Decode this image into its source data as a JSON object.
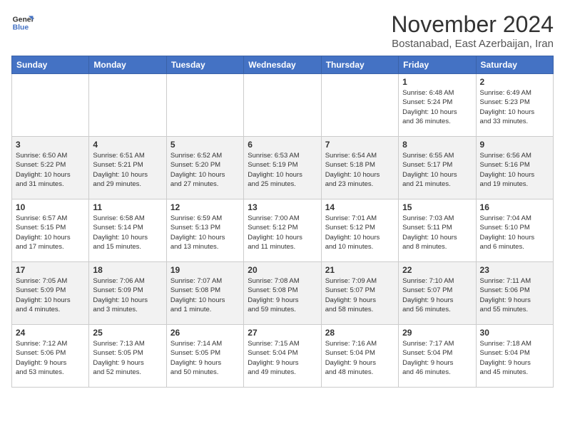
{
  "header": {
    "logo_line1": "General",
    "logo_line2": "Blue",
    "month": "November 2024",
    "location": "Bostanabad, East Azerbaijan, Iran"
  },
  "weekdays": [
    "Sunday",
    "Monday",
    "Tuesday",
    "Wednesday",
    "Thursday",
    "Friday",
    "Saturday"
  ],
  "weeks": [
    [
      {
        "day": "",
        "info": ""
      },
      {
        "day": "",
        "info": ""
      },
      {
        "day": "",
        "info": ""
      },
      {
        "day": "",
        "info": ""
      },
      {
        "day": "",
        "info": ""
      },
      {
        "day": "1",
        "info": "Sunrise: 6:48 AM\nSunset: 5:24 PM\nDaylight: 10 hours\nand 36 minutes."
      },
      {
        "day": "2",
        "info": "Sunrise: 6:49 AM\nSunset: 5:23 PM\nDaylight: 10 hours\nand 33 minutes."
      }
    ],
    [
      {
        "day": "3",
        "info": "Sunrise: 6:50 AM\nSunset: 5:22 PM\nDaylight: 10 hours\nand 31 minutes."
      },
      {
        "day": "4",
        "info": "Sunrise: 6:51 AM\nSunset: 5:21 PM\nDaylight: 10 hours\nand 29 minutes."
      },
      {
        "day": "5",
        "info": "Sunrise: 6:52 AM\nSunset: 5:20 PM\nDaylight: 10 hours\nand 27 minutes."
      },
      {
        "day": "6",
        "info": "Sunrise: 6:53 AM\nSunset: 5:19 PM\nDaylight: 10 hours\nand 25 minutes."
      },
      {
        "day": "7",
        "info": "Sunrise: 6:54 AM\nSunset: 5:18 PM\nDaylight: 10 hours\nand 23 minutes."
      },
      {
        "day": "8",
        "info": "Sunrise: 6:55 AM\nSunset: 5:17 PM\nDaylight: 10 hours\nand 21 minutes."
      },
      {
        "day": "9",
        "info": "Sunrise: 6:56 AM\nSunset: 5:16 PM\nDaylight: 10 hours\nand 19 minutes."
      }
    ],
    [
      {
        "day": "10",
        "info": "Sunrise: 6:57 AM\nSunset: 5:15 PM\nDaylight: 10 hours\nand 17 minutes."
      },
      {
        "day": "11",
        "info": "Sunrise: 6:58 AM\nSunset: 5:14 PM\nDaylight: 10 hours\nand 15 minutes."
      },
      {
        "day": "12",
        "info": "Sunrise: 6:59 AM\nSunset: 5:13 PM\nDaylight: 10 hours\nand 13 minutes."
      },
      {
        "day": "13",
        "info": "Sunrise: 7:00 AM\nSunset: 5:12 PM\nDaylight: 10 hours\nand 11 minutes."
      },
      {
        "day": "14",
        "info": "Sunrise: 7:01 AM\nSunset: 5:12 PM\nDaylight: 10 hours\nand 10 minutes."
      },
      {
        "day": "15",
        "info": "Sunrise: 7:03 AM\nSunset: 5:11 PM\nDaylight: 10 hours\nand 8 minutes."
      },
      {
        "day": "16",
        "info": "Sunrise: 7:04 AM\nSunset: 5:10 PM\nDaylight: 10 hours\nand 6 minutes."
      }
    ],
    [
      {
        "day": "17",
        "info": "Sunrise: 7:05 AM\nSunset: 5:09 PM\nDaylight: 10 hours\nand 4 minutes."
      },
      {
        "day": "18",
        "info": "Sunrise: 7:06 AM\nSunset: 5:09 PM\nDaylight: 10 hours\nand 3 minutes."
      },
      {
        "day": "19",
        "info": "Sunrise: 7:07 AM\nSunset: 5:08 PM\nDaylight: 10 hours\nand 1 minute."
      },
      {
        "day": "20",
        "info": "Sunrise: 7:08 AM\nSunset: 5:08 PM\nDaylight: 9 hours\nand 59 minutes."
      },
      {
        "day": "21",
        "info": "Sunrise: 7:09 AM\nSunset: 5:07 PM\nDaylight: 9 hours\nand 58 minutes."
      },
      {
        "day": "22",
        "info": "Sunrise: 7:10 AM\nSunset: 5:07 PM\nDaylight: 9 hours\nand 56 minutes."
      },
      {
        "day": "23",
        "info": "Sunrise: 7:11 AM\nSunset: 5:06 PM\nDaylight: 9 hours\nand 55 minutes."
      }
    ],
    [
      {
        "day": "24",
        "info": "Sunrise: 7:12 AM\nSunset: 5:06 PM\nDaylight: 9 hours\nand 53 minutes."
      },
      {
        "day": "25",
        "info": "Sunrise: 7:13 AM\nSunset: 5:05 PM\nDaylight: 9 hours\nand 52 minutes."
      },
      {
        "day": "26",
        "info": "Sunrise: 7:14 AM\nSunset: 5:05 PM\nDaylight: 9 hours\nand 50 minutes."
      },
      {
        "day": "27",
        "info": "Sunrise: 7:15 AM\nSunset: 5:04 PM\nDaylight: 9 hours\nand 49 minutes."
      },
      {
        "day": "28",
        "info": "Sunrise: 7:16 AM\nSunset: 5:04 PM\nDaylight: 9 hours\nand 48 minutes."
      },
      {
        "day": "29",
        "info": "Sunrise: 7:17 AM\nSunset: 5:04 PM\nDaylight: 9 hours\nand 46 minutes."
      },
      {
        "day": "30",
        "info": "Sunrise: 7:18 AM\nSunset: 5:04 PM\nDaylight: 9 hours\nand 45 minutes."
      }
    ]
  ]
}
